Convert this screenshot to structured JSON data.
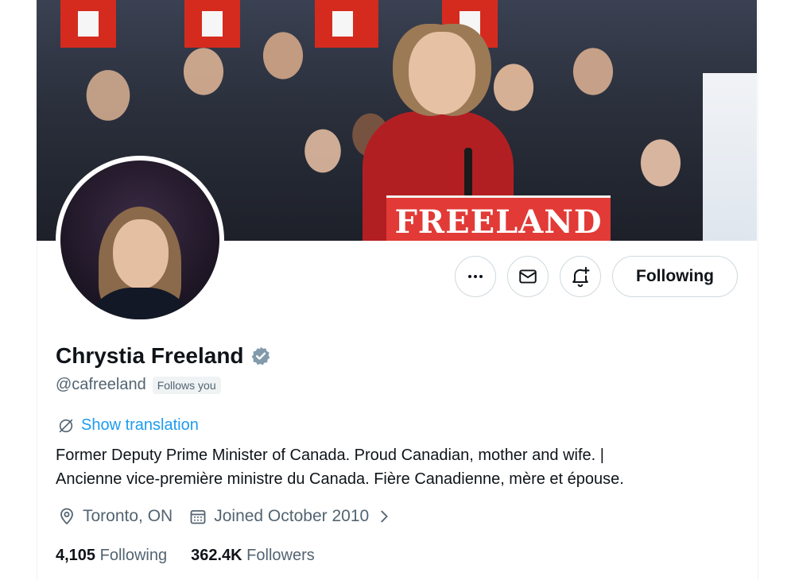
{
  "banner": {
    "sign_text": "FREELAND"
  },
  "profile": {
    "name": "Chrystia Freeland",
    "handle": "@cafreeland",
    "follows_you": "Follows you",
    "show_translation": "Show translation",
    "bio_line1": "Former Deputy Prime Minister of Canada. Proud Canadian, mother and wife. |",
    "bio_line2": "Ancienne vice-première ministre du Canada. Fière Canadienne, mère et épouse.",
    "location": "Toronto, ON",
    "joined": "Joined October 2010"
  },
  "actions": {
    "more_icon": "more-icon",
    "message_icon": "envelope-icon",
    "notify_icon": "bell-plus-icon",
    "follow_label": "Following"
  },
  "stats": {
    "following_count": "4,105",
    "following_label": "Following",
    "followers_count": "362.4K",
    "followers_label": "Followers"
  },
  "colors": {
    "accent": "#1d9bf0",
    "verified": "#829aab",
    "secondary_text": "#536471",
    "primary_text": "#0f1419",
    "sign_red": "#e23a36"
  }
}
